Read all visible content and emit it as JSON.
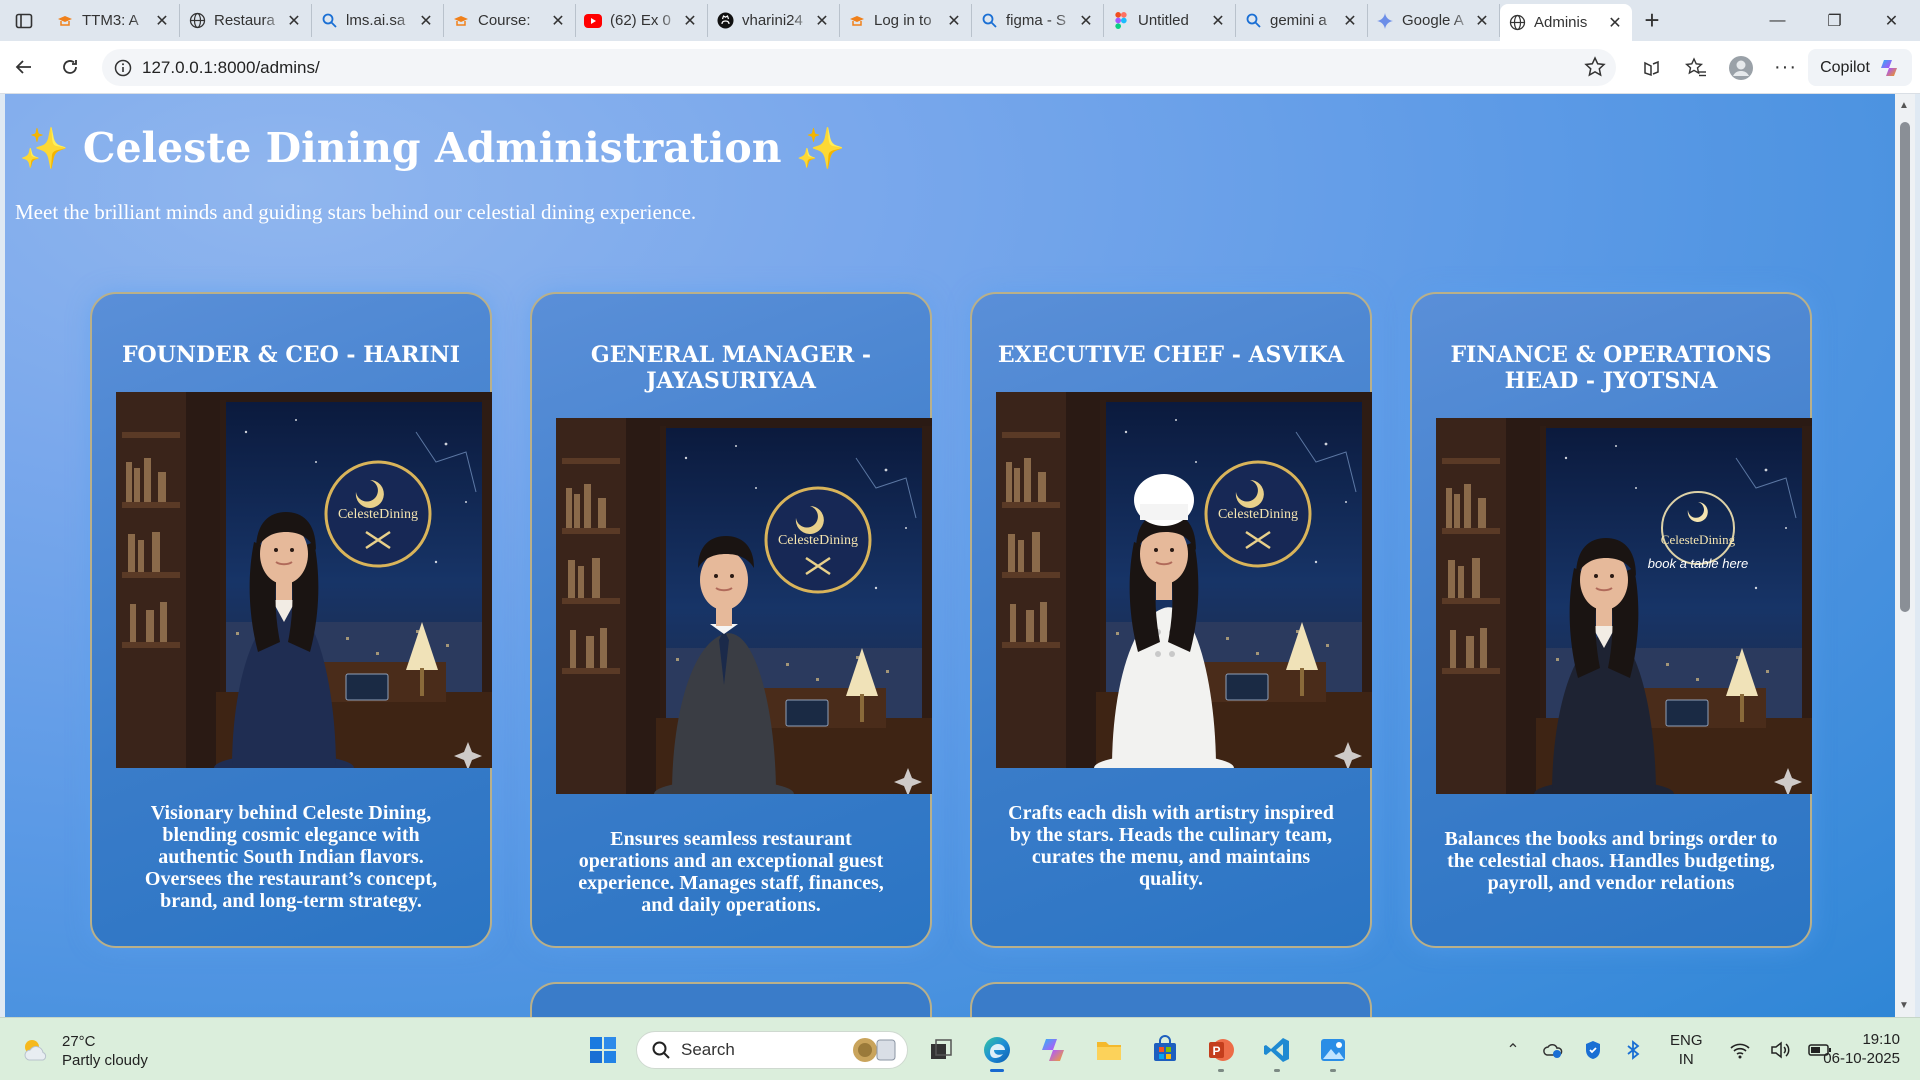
{
  "browser": {
    "tabs": [
      {
        "title": "TTM3: A",
        "icon": "moodle-hat-icon",
        "active": false
      },
      {
        "title": "Restaura",
        "icon": "globe-icon",
        "active": false
      },
      {
        "title": "lms.ai.sa",
        "icon": "search-icon",
        "active": false
      },
      {
        "title": "Course:",
        "icon": "moodle-hat-icon",
        "active": false
      },
      {
        "title": "(62) Ex 0",
        "icon": "youtube-icon",
        "active": false
      },
      {
        "title": "vharini24",
        "icon": "github-icon",
        "active": false
      },
      {
        "title": "Log in to",
        "icon": "moodle-hat-icon",
        "active": false
      },
      {
        "title": "figma - S",
        "icon": "search-icon",
        "active": false
      },
      {
        "title": "Untitled",
        "icon": "figma-icon",
        "active": false
      },
      {
        "title": "gemini a",
        "icon": "search-icon",
        "active": false
      },
      {
        "title": "Google A",
        "icon": "gemini-icon",
        "active": false
      },
      {
        "title": "Adminis",
        "icon": "globe-icon",
        "active": true
      }
    ],
    "url": "127.0.0.1:8000/admins/",
    "copilot_label": "Copilot"
  },
  "page": {
    "title": "Celeste Dining Administration",
    "subtitle": "Meet the brilliant minds and guiding stars behind our celestial dining experience.",
    "accent_color": "#f3c13a",
    "admins": [
      {
        "role": "FOUNDER & CEO - HARINI",
        "description": "Visionary behind Celeste Dining, blending cosmic elegance with authentic South Indian flavors. Oversees the restaurant’s concept, brand, and long-term strategy.",
        "attire": "navy-suit-woman",
        "emblem_text": "CelesteDining"
      },
      {
        "role": "GENERAL MANAGER - JAYASURIYAA",
        "description": "Ensures seamless restaurant operations and an exceptional guest experience. Manages staff, finances, and daily operations.",
        "attire": "grey-suit-man",
        "emblem_text": "CelesteDining"
      },
      {
        "role": "EXECUTIVE CHEF - ASVIKA",
        "description": "Crafts each dish with artistry inspired by the stars. Heads the culinary team, curates the menu, and maintains quality.",
        "attire": "chef-whites-woman",
        "emblem_text": "CelesteDining"
      },
      {
        "role": "FINANCE & OPERATIONS HEAD - JYOTSNA",
        "description": "Balances the books and brings order to the celestial chaos. Handles budgeting, payroll, and vendor relations",
        "attire": "black-suit-woman",
        "emblem_text": "CelesteDining",
        "emblem_sub": "book a table here"
      }
    ]
  },
  "taskbar": {
    "weather_temp": "27°C",
    "weather_desc": "Partly cloudy",
    "search_placeholder": "Search",
    "lang_top": "ENG",
    "lang_bottom": "IN",
    "time": "19:10",
    "date": "06-10-2025"
  }
}
